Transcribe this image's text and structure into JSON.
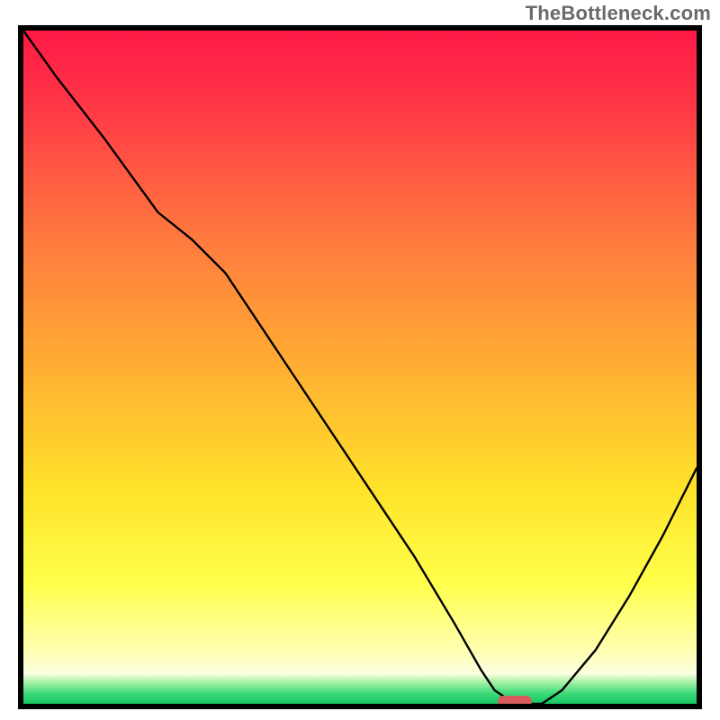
{
  "watermark": "TheBottleneck.com",
  "chart_data": {
    "type": "line",
    "title": "",
    "xlabel": "",
    "ylabel": "",
    "xlim": [
      0,
      100
    ],
    "ylim": [
      0,
      100
    ],
    "grid": false,
    "axes_visible": false,
    "background": {
      "description": "vertical gradient red→orange→yellow→pale-yellow with thin green band at bottom",
      "stops": [
        {
          "pos": 0.0,
          "color": "#ff1846"
        },
        {
          "pos": 0.12,
          "color": "#ff3a46"
        },
        {
          "pos": 0.3,
          "color": "#ff773f"
        },
        {
          "pos": 0.5,
          "color": "#ffae33"
        },
        {
          "pos": 0.68,
          "color": "#ffe22a"
        },
        {
          "pos": 0.82,
          "color": "#ffff4a"
        },
        {
          "pos": 0.92,
          "color": "#ffffb0"
        },
        {
          "pos": 0.955,
          "color": "#fbffe0"
        },
        {
          "pos": 0.965,
          "color": "#b8f5b0"
        },
        {
          "pos": 0.985,
          "color": "#3bd977"
        },
        {
          "pos": 1.0,
          "color": "#17c765"
        }
      ]
    },
    "series": [
      {
        "name": "bottleneck-curve",
        "description": "V-shaped curve; starts top-left, dips to ~0 near x≈73, rises toward upper-right",
        "x": [
          0,
          5,
          12,
          20,
          25,
          30,
          40,
          50,
          58,
          64,
          68,
          70,
          73,
          77,
          80,
          85,
          90,
          95,
          100
        ],
        "y": [
          100,
          93,
          84,
          73,
          69,
          64,
          49,
          34,
          22,
          12,
          5,
          2,
          0,
          0,
          2,
          8,
          16,
          25,
          35
        ]
      }
    ],
    "annotations": [
      {
        "name": "optimal-marker",
        "shape": "rounded-rect",
        "x": 73,
        "y": 0.3,
        "width_pct": 5.0,
        "height_pct": 1.8,
        "color": "#d85a5a"
      }
    ]
  }
}
